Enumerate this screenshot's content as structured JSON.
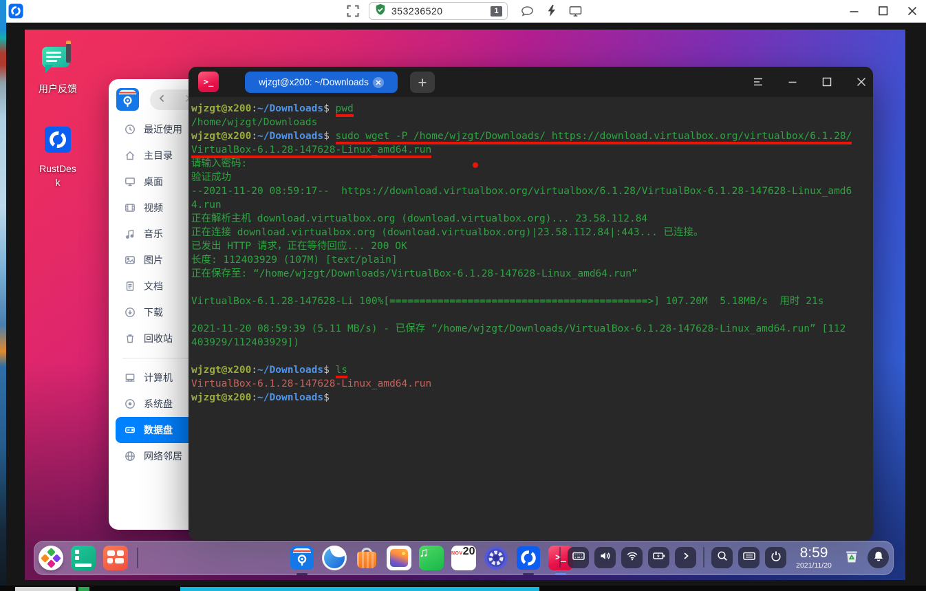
{
  "colors": {
    "accent_blue": "#0081ff",
    "terminal_tab_blue": "#1a66d6",
    "terminal_green": "#2fa342",
    "prompt_host_green": "#9aab3f",
    "prompt_path_blue": "#4f94e8",
    "listing_file_red": "#c7625c",
    "annotation_red": "#ea1509"
  },
  "rustdesk_toolbar": {
    "session_id": "353236520",
    "unread_badge": "1"
  },
  "desktop": {
    "icons": [
      {
        "name": "user-feedback",
        "label": "用户反馈"
      },
      {
        "name": "rustdesk",
        "label": "RustDesk"
      }
    ]
  },
  "file_manager": {
    "sidebar": [
      {
        "icon": "clock",
        "label": "最近使用"
      },
      {
        "icon": "home",
        "label": "主目录"
      },
      {
        "icon": "desktop",
        "label": "桌面"
      },
      {
        "icon": "video",
        "label": "视频"
      },
      {
        "icon": "music",
        "label": "音乐"
      },
      {
        "icon": "image",
        "label": "图片"
      },
      {
        "icon": "document",
        "label": "文档"
      },
      {
        "icon": "download",
        "label": "下载"
      },
      {
        "icon": "trash",
        "label": "回收站"
      },
      {
        "divider": true
      },
      {
        "icon": "computer",
        "label": "计算机"
      },
      {
        "icon": "system-disk",
        "label": "系统盘"
      },
      {
        "icon": "data-disk",
        "label": "数据盘",
        "selected": true
      },
      {
        "icon": "network",
        "label": "网络邻居"
      }
    ]
  },
  "terminal": {
    "tab_title": "wjzgt@x200: ~/Downloads",
    "lines": [
      [
        {
          "t": "wjzgt@x200",
          "c": "h"
        },
        {
          "t": ":",
          "c": "s"
        },
        {
          "t": "~/Downloads",
          "c": "p"
        },
        {
          "t": "$ ",
          "c": "s"
        },
        {
          "t": "pwd",
          "c": "g",
          "u": 1
        }
      ],
      [
        {
          "t": "/home/wjzgt/Downloads",
          "c": "g"
        }
      ],
      [
        {
          "t": "wjzgt@x200",
          "c": "h"
        },
        {
          "t": ":",
          "c": "s"
        },
        {
          "t": "~/Downloads",
          "c": "p"
        },
        {
          "t": "$ ",
          "c": "s"
        },
        {
          "t": "sudo wget -P /home/wjzgt/Downloads/ https://download.virtualbox.org/virtualbox/6.1.28/",
          "c": "g",
          "u": 1
        }
      ],
      [
        {
          "t": "VirtualBox-6.1.28-147628-Linux_amd64.run",
          "c": "g",
          "u": 1
        }
      ],
      [
        {
          "t": "请输入密码:",
          "c": "g"
        }
      ],
      [
        {
          "t": "验证成功",
          "c": "g"
        }
      ],
      [
        {
          "t": "--2021-11-20 08:59:17--  https://download.virtualbox.org/virtualbox/6.1.28/VirtualBox-6.1.28-147628-Linux_amd6",
          "c": "g"
        }
      ],
      [
        {
          "t": "4.run",
          "c": "g"
        }
      ],
      [
        {
          "t": "正在解析主机 download.virtualbox.org (download.virtualbox.org)... 23.58.112.84",
          "c": "g"
        }
      ],
      [
        {
          "t": "正在连接 download.virtualbox.org (download.virtualbox.org)|23.58.112.84|:443... 已连接。",
          "c": "g"
        }
      ],
      [
        {
          "t": "已发出 HTTP 请求，正在等待回应... 200 OK",
          "c": "g"
        }
      ],
      [
        {
          "t": "长度: 112403929 (107M) [text/plain]",
          "c": "g"
        }
      ],
      [
        {
          "t": "正在保存至: “/home/wjzgt/Downloads/VirtualBox-6.1.28-147628-Linux_amd64.run”",
          "c": "g"
        }
      ],
      [],
      [
        {
          "t": "VirtualBox-6.1.28-147628-Li 100%[===========================================>] 107.20M  5.18MB/s  用时 21s",
          "c": "g"
        }
      ],
      [],
      [
        {
          "t": "2021-11-20 08:59:39 (5.11 MB/s) - 已保存 “/home/wjzgt/Downloads/VirtualBox-6.1.28-147628-Linux_amd64.run” [112",
          "c": "g"
        }
      ],
      [
        {
          "t": "403929/112403929])",
          "c": "g"
        }
      ],
      [],
      [
        {
          "t": "wjzgt@x200",
          "c": "h"
        },
        {
          "t": ":",
          "c": "s"
        },
        {
          "t": "~/Downloads",
          "c": "p"
        },
        {
          "t": "$ ",
          "c": "s"
        },
        {
          "t": "ls",
          "c": "g",
          "u": 1
        }
      ],
      [
        {
          "t": "VirtualBox-6.1.28-147628-Linux_amd64.run",
          "c": "f"
        }
      ],
      [
        {
          "t": "wjzgt@x200",
          "c": "h"
        },
        {
          "t": ":",
          "c": "s"
        },
        {
          "t": "~/Downloads",
          "c": "p"
        },
        {
          "t": "$",
          "c": "s"
        }
      ]
    ]
  },
  "dock": {
    "left_items": [
      {
        "name": "launcher"
      },
      {
        "name": "multitasking"
      },
      {
        "name": "app-grid"
      }
    ],
    "apps": [
      {
        "name": "file-manager",
        "running": true
      },
      {
        "name": "browser"
      },
      {
        "name": "app-store"
      },
      {
        "name": "image-viewer"
      },
      {
        "name": "music"
      },
      {
        "name": "calendar"
      },
      {
        "name": "control-center"
      },
      {
        "name": "rustdesk",
        "running": true
      },
      {
        "name": "terminal",
        "running": true,
        "active": true
      }
    ],
    "calendar_badge": {
      "month": "NOV",
      "day": "20"
    },
    "tray": [
      {
        "name": "keyboard"
      },
      {
        "name": "volume"
      },
      {
        "name": "wifi"
      },
      {
        "name": "battery"
      },
      {
        "name": "expand"
      }
    ],
    "tray2": [
      {
        "name": "search"
      },
      {
        "name": "onscreen-keyboard"
      },
      {
        "name": "power"
      }
    ],
    "clock": {
      "time": "8:59",
      "date": "2021/11/20"
    },
    "right_items": [
      {
        "name": "trash"
      },
      {
        "name": "notifications"
      }
    ]
  }
}
